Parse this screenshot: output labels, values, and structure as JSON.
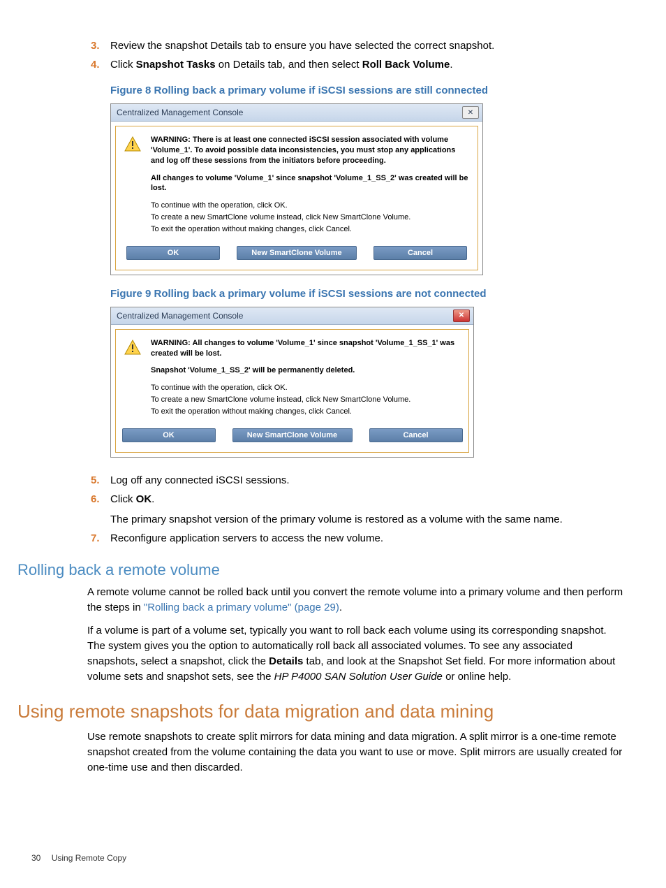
{
  "steps_a": [
    {
      "n": "3.",
      "text": "Review the snapshot Details tab to ensure you have selected the correct snapshot."
    },
    {
      "n": "4.",
      "prefix": "Click ",
      "b1": "Snapshot Tasks",
      "mid": " on Details tab, and then select ",
      "b2": "Roll Back Volume",
      "suffix": "."
    }
  ],
  "fig8_caption": "Figure 8 Rolling back a primary volume if iSCSI sessions are still connected",
  "dialog1": {
    "title": "Centralized Management Console",
    "close": "✕",
    "warn_bold": "WARNING: There is at least one connected iSCSI session associated with volume 'Volume_1'. To avoid possible data inconsistencies, you must stop any applications and log off these sessions from the initiators before proceeding.",
    "l1": "All changes to volume 'Volume_1' since snapshot 'Volume_1_SS_2' was created will be lost.",
    "l2": "To continue with the operation, click OK.",
    "l3": "To create a new SmartClone volume instead, click New SmartClone Volume.",
    "l4": "To exit the operation without making changes, click Cancel.",
    "btn_ok": "OK",
    "btn_new": "New SmartClone Volume",
    "btn_cancel": "Cancel"
  },
  "fig9_caption": "Figure 9 Rolling back a primary volume if iSCSI sessions are not connected",
  "dialog2": {
    "title": "Centralized Management Console",
    "close": "✕",
    "warn_bold": "WARNING: All changes to volume 'Volume_1' since snapshot 'Volume_1_SS_1' was created will be lost.",
    "l1": "Snapshot 'Volume_1_SS_2' will be permanently deleted.",
    "l2": "To continue with the operation, click OK.",
    "l3": "To create a new SmartClone volume instead, click New SmartClone Volume.",
    "l4": "To exit the operation without making changes, click Cancel.",
    "btn_ok": "OK",
    "btn_new": "New SmartClone Volume",
    "btn_cancel": "Cancel"
  },
  "steps_b": [
    {
      "n": "5.",
      "text": "Log off any connected iSCSI sessions."
    },
    {
      "n": "6.",
      "prefix": "Click ",
      "b1": "OK",
      "suffix": ".",
      "sub": "The primary snapshot version of the primary volume is restored as a volume with the same name."
    },
    {
      "n": "7.",
      "text": "Reconfigure application servers to access the new volume."
    }
  ],
  "h3_remote": "Rolling back a remote volume",
  "remote_p1a": "A remote volume cannot be rolled back until you convert the remote volume into a primary volume and then perform the steps in ",
  "remote_link": "\"Rolling back a primary volume\" (page 29)",
  "remote_p1b": ".",
  "remote_p2a": "If a volume is part of a volume set, typically you want to roll back each volume using its corresponding snapshot. The system gives you the option to automatically roll back all associated volumes. To see any associated snapshots, select a snapshot, click the ",
  "remote_p2_b": "Details",
  "remote_p2c": " tab, and look at the Snapshot Set field. For more information about volume sets and snapshot sets, see the ",
  "remote_p2_i": "HP P4000 SAN Solution User Guide",
  "remote_p2d": " or online help.",
  "h2_mig": "Using remote snapshots for data migration and data mining",
  "mig_p": "Use remote snapshots to create split mirrors for data mining and data migration. A split mirror is a one-time remote snapshot created from the volume containing the data you want to use or move. Split mirrors are usually created for one-time use and then discarded.",
  "footer_page": "30",
  "footer_section": "Using Remote Copy"
}
